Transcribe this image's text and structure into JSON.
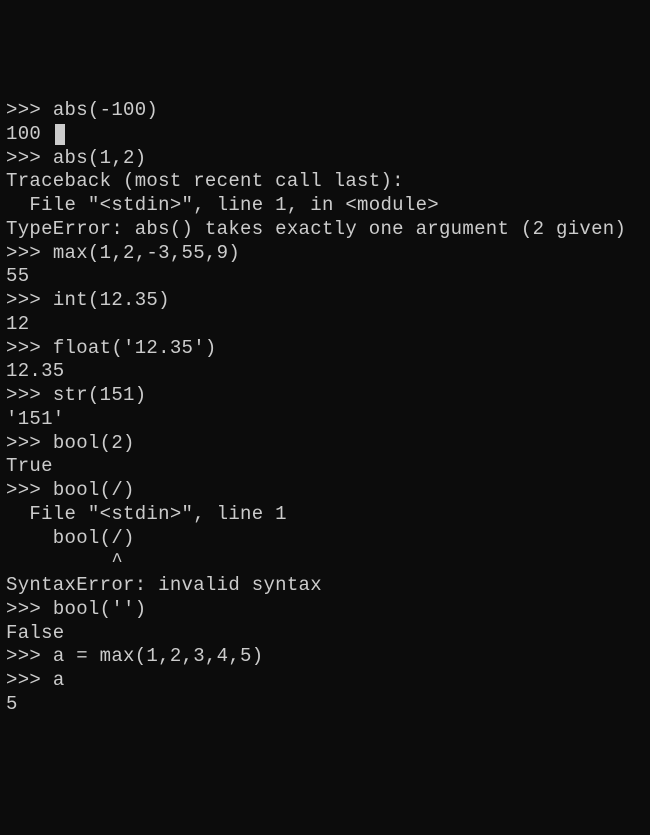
{
  "prompt": ">>> ",
  "session": {
    "lines": [
      {
        "type": "prompt",
        "text": "abs(-100)"
      },
      {
        "type": "output_cursor",
        "text": "100 "
      },
      {
        "type": "prompt",
        "text": "abs(1,2)"
      },
      {
        "type": "output",
        "text": "Traceback (most recent call last):"
      },
      {
        "type": "output",
        "text": "  File \"<stdin>\", line 1, in <module>"
      },
      {
        "type": "output",
        "text": "TypeError: abs() takes exactly one argument (2 given)"
      },
      {
        "type": "prompt",
        "text": "max(1,2,-3,55,9)"
      },
      {
        "type": "output",
        "text": "55"
      },
      {
        "type": "prompt",
        "text": "int(12.35)"
      },
      {
        "type": "output",
        "text": "12"
      },
      {
        "type": "prompt",
        "text": "float('12.35')"
      },
      {
        "type": "output",
        "text": "12.35"
      },
      {
        "type": "prompt",
        "text": "str(151)"
      },
      {
        "type": "output",
        "text": "'151'"
      },
      {
        "type": "prompt",
        "text": "bool(2)"
      },
      {
        "type": "output",
        "text": "True"
      },
      {
        "type": "prompt",
        "text": "bool(/)"
      },
      {
        "type": "output",
        "text": "  File \"<stdin>\", line 1"
      },
      {
        "type": "output",
        "text": "    bool(/)"
      },
      {
        "type": "output",
        "text": "         ^"
      },
      {
        "type": "output",
        "text": "SyntaxError: invalid syntax"
      },
      {
        "type": "prompt",
        "text": "bool('')"
      },
      {
        "type": "output",
        "text": "False"
      },
      {
        "type": "prompt",
        "text": "a = max(1,2,3,4,5)"
      },
      {
        "type": "prompt",
        "text": "a"
      },
      {
        "type": "output",
        "text": "5"
      }
    ]
  }
}
